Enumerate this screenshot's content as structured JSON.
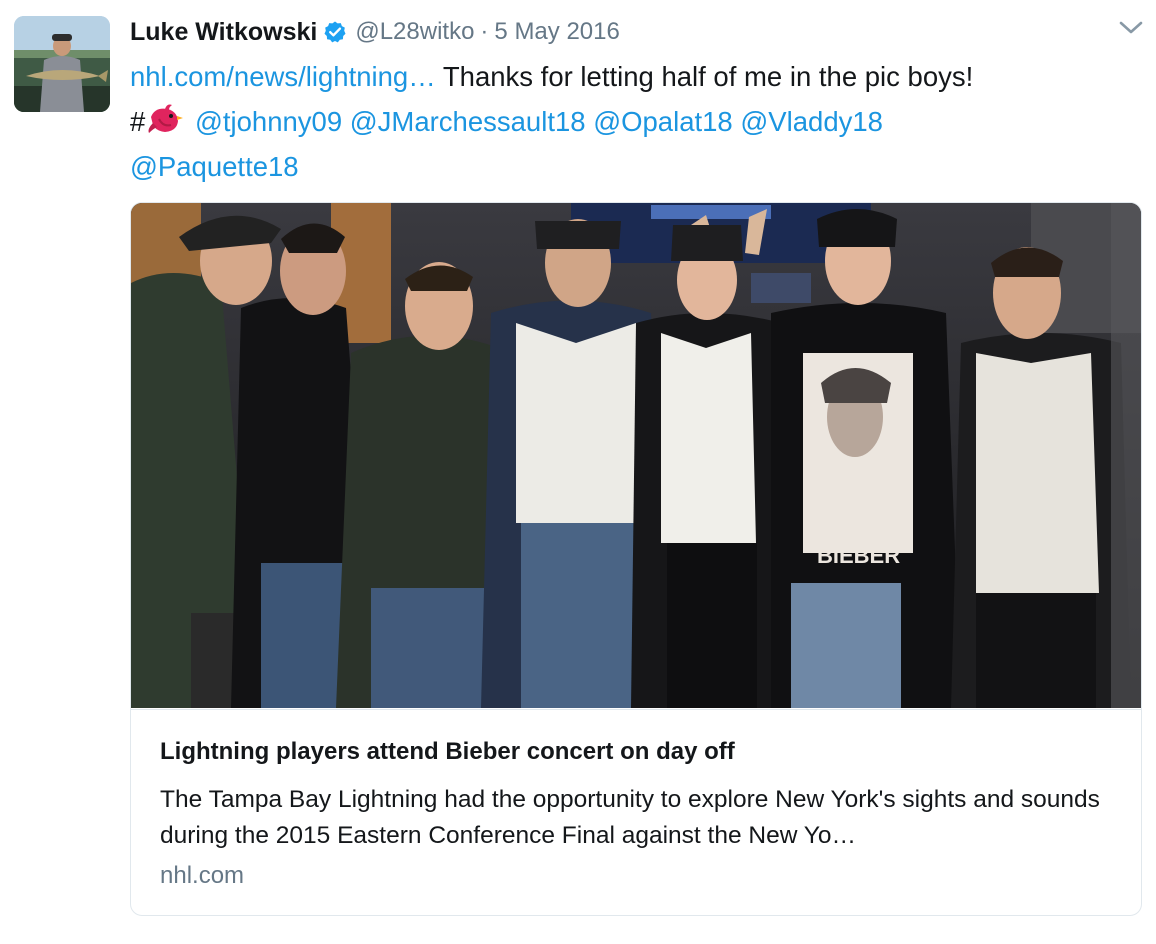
{
  "tweet": {
    "author_name": "Luke Witkowski",
    "handle": "@L28witko",
    "separator": "·",
    "date": "5 May 2016",
    "text": {
      "link": "nhl.com/news/lightning…",
      "body": " Thanks for letting half of me in the pic boys!",
      "hash": "#",
      "mentions": [
        "@tjohnny09",
        "@JMarchessault18",
        "@Opalat18",
        "@Vladdy18",
        "@Paquette18"
      ]
    }
  },
  "card": {
    "title": "Lightning players attend Bieber concert on day off",
    "description": "The Tampa Bay Lightning had the opportunity to explore New York's sights and sounds during the 2015 Eastern Conference Final against the New Yo…",
    "domain": "nhl.com",
    "photo_shirt_text": "BIEBER"
  },
  "icons": {
    "verified": "verified-badge-icon",
    "chevron": "chevron-down-icon",
    "bird": "red-bird-hashflag-icon"
  },
  "colors": {
    "link": "#1b95e0",
    "secondary_text": "#657786",
    "verified": "#1da1f2",
    "border": "#e1e8ed"
  }
}
